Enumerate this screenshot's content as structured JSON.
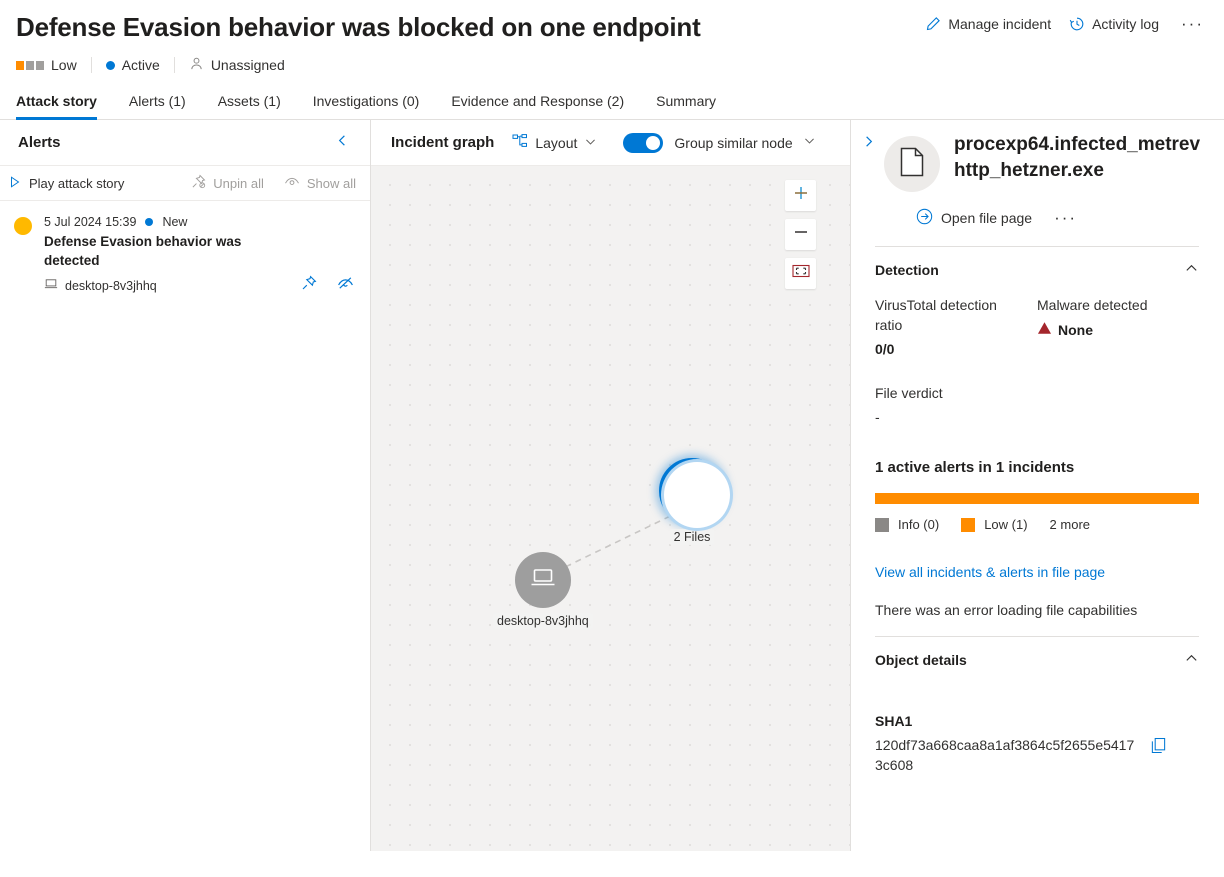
{
  "header": {
    "title": "Defense Evasion behavior was blocked on one endpoint",
    "manage_incident": "Manage incident",
    "activity_log": "Activity log",
    "more_label": "···",
    "severity": "Low",
    "status": "Active",
    "assignee": "Unassigned",
    "severity_color": "#ff8c00",
    "status_color": "#0078d4"
  },
  "tabs": [
    {
      "label": "Attack story",
      "active": true
    },
    {
      "label": "Alerts (1)",
      "active": false
    },
    {
      "label": "Assets (1)",
      "active": false
    },
    {
      "label": "Investigations (0)",
      "active": false
    },
    {
      "label": "Evidence and Response (2)",
      "active": false
    },
    {
      "label": "Summary",
      "active": false
    }
  ],
  "alerts_pane": {
    "title": "Alerts",
    "play_attack_story": "Play attack story",
    "unpin_all": "Unpin all",
    "show_all": "Show all",
    "alert": {
      "timestamp": "5 Jul 2024 15:39",
      "state": "New",
      "title": "Defense Evasion behavior was detected",
      "device": "desktop-8v3jhhq",
      "bullet_color": "#ffb900"
    }
  },
  "graph": {
    "title": "Incident graph",
    "layout_label": "Layout",
    "group_similar_label": "Group similar nodes",
    "group_similar_on": true,
    "zoom_in": "+",
    "zoom_out": "−",
    "nodes": [
      {
        "id": "files",
        "label": "2 Files",
        "type": "file",
        "selected": true
      },
      {
        "id": "device",
        "label": "desktop-8v3jhhq",
        "type": "device",
        "selected": false
      }
    ]
  },
  "details": {
    "file_name": "procexp64.infected_metrevhttp_hetzner.exe",
    "open_file_page": "Open file page",
    "more_label": "···",
    "detection": {
      "heading": "Detection",
      "vt_label": "VirusTotal detection ratio",
      "vt_value": "0/0",
      "malware_label": "Malware detected",
      "malware_value": "None",
      "verdict_label": "File verdict",
      "verdict_value": "-"
    },
    "alerts_summary": {
      "title": "1 active alerts in 1 incidents",
      "legend": [
        {
          "label": "Info (0)",
          "color": "#8a8886"
        },
        {
          "label": "Low (1)",
          "color": "#ff8c00"
        }
      ],
      "more": "2 more",
      "bar_color": "#ff8c00"
    },
    "view_all_link": "View all incidents & alerts in file page",
    "capabilities_error": "There was an error loading file capabilities",
    "object_details": {
      "heading": "Object details",
      "sha1_label": "SHA1",
      "sha1_value": "120df73a668caa8a1af3864c5f2655e54173c608"
    }
  }
}
